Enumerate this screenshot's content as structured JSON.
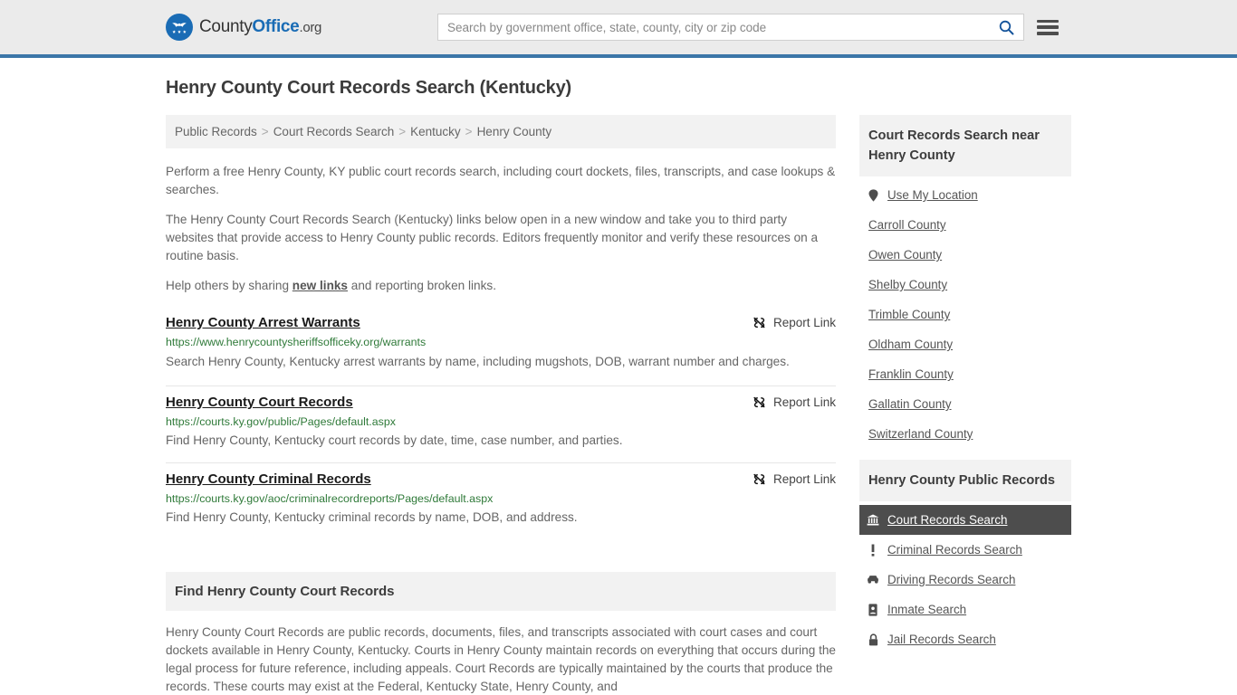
{
  "header": {
    "logo": {
      "part1": "County",
      "part2": "Office",
      "part3": ".org",
      "icon": "eagle-seal-icon"
    },
    "search": {
      "placeholder": "Search by government office, state, county, city or zip code",
      "value": "",
      "icon": "search-icon"
    },
    "menu_icon": "hamburger-menu-icon",
    "accent_color": "#3b76a8",
    "background_color": "#ebebeb"
  },
  "page": {
    "title": "Henry County Court Records Search (Kentucky)"
  },
  "breadcrumb": {
    "items": [
      {
        "label": "Public Records"
      },
      {
        "label": "Court Records Search"
      },
      {
        "label": "Kentucky"
      },
      {
        "label": "Henry County"
      }
    ],
    "separator": ">"
  },
  "intro": {
    "p1": "Perform a free Henry County, KY public court records search, including court dockets, files, transcripts, and case lookups & searches.",
    "p2": "The Henry County Court Records Search (Kentucky) links below open in a new window and take you to third party websites that provide access to Henry County public records. Editors frequently monitor and verify these resources on a routine basis.",
    "p3_before": "Help others by sharing ",
    "p3_link": "new links",
    "p3_after": " and reporting broken links."
  },
  "report_link_label": "Report Link",
  "report_link_icon": "broken-link-icon",
  "results": [
    {
      "title": "Henry County Arrest Warrants",
      "url": "https://www.henrycountysheriffsofficeky.org/warrants",
      "description": "Search Henry County, Kentucky arrest warrants by name, including mugshots, DOB, warrant number and charges."
    },
    {
      "title": "Henry County Court Records",
      "url": "https://courts.ky.gov/public/Pages/default.aspx",
      "description": "Find Henry County, Kentucky court records by date, time, case number, and parties."
    },
    {
      "title": "Henry County Criminal Records",
      "url": "https://courts.ky.gov/aoc/criminalrecordreports/Pages/default.aspx",
      "description": "Find Henry County, Kentucky criminal records by name, DOB, and address."
    }
  ],
  "find_section": {
    "heading": "Find Henry County Court Records",
    "body": "Henry County Court Records are public records, documents, files, and transcripts associated with court cases and court dockets available in Henry County, Kentucky. Courts in Henry County maintain records on everything that occurs during the legal process for future reference, including appeals. Court Records are typically maintained by the courts that produce the records. These courts may exist at the Federal, Kentucky State, Henry County, and"
  },
  "sidebar": {
    "nearby": {
      "heading": "Court Records Search near Henry County",
      "items": [
        {
          "label": "Use My Location",
          "icon": "map-pin-icon"
        },
        {
          "label": "Carroll County",
          "icon": null
        },
        {
          "label": "Owen County",
          "icon": null
        },
        {
          "label": "Shelby County",
          "icon": null
        },
        {
          "label": "Trimble County",
          "icon": null
        },
        {
          "label": "Oldham County",
          "icon": null
        },
        {
          "label": "Franklin County",
          "icon": null
        },
        {
          "label": "Gallatin County",
          "icon": null
        },
        {
          "label": "Switzerland County",
          "icon": null
        }
      ]
    },
    "public_records": {
      "heading": "Henry County Public Records",
      "items": [
        {
          "label": "Court Records Search",
          "icon": "courthouse-icon",
          "active": true
        },
        {
          "label": "Criminal Records Search",
          "icon": "exclamation-icon",
          "active": false
        },
        {
          "label": "Driving Records Search",
          "icon": "car-icon",
          "active": false
        },
        {
          "label": "Inmate Search",
          "icon": "id-badge-icon",
          "active": false
        },
        {
          "label": "Jail Records Search",
          "icon": "lock-icon",
          "active": false
        }
      ]
    },
    "active_background_color": "#4d4d4d"
  }
}
